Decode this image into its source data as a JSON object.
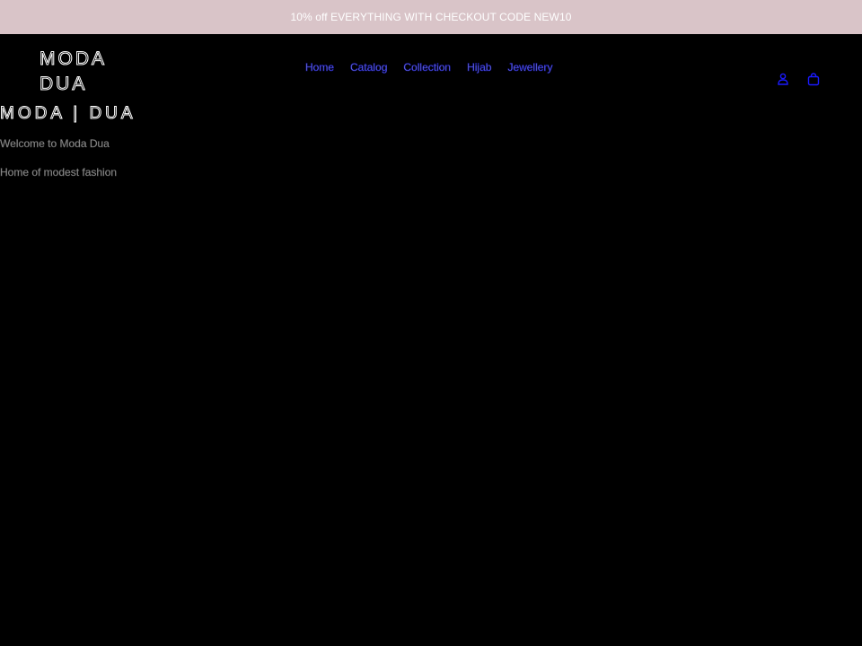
{
  "announcement": {
    "text": "10% off EVERYTHING WITH CHECKOUT CODE NEW10"
  },
  "header": {
    "logo": {
      "line1": "MODA",
      "line2": "DUA"
    },
    "nav": [
      {
        "label": "Home"
      },
      {
        "label": "Catalog"
      },
      {
        "label": "Collection"
      },
      {
        "label": "Hijab"
      },
      {
        "label": "Jewellery"
      }
    ],
    "icons": {
      "account": "account-icon",
      "cart": "cart-icon"
    }
  },
  "main": {
    "brand_banner": "MODA | DUA",
    "welcome": "Welcome to Moda Dua",
    "tagline": "Home of modest fashion"
  },
  "colors": {
    "announcement_bg": "#d9c4c8",
    "page_bg": "#000000",
    "nav_link": "#8a8ef0",
    "icon": "#1a1aff"
  }
}
